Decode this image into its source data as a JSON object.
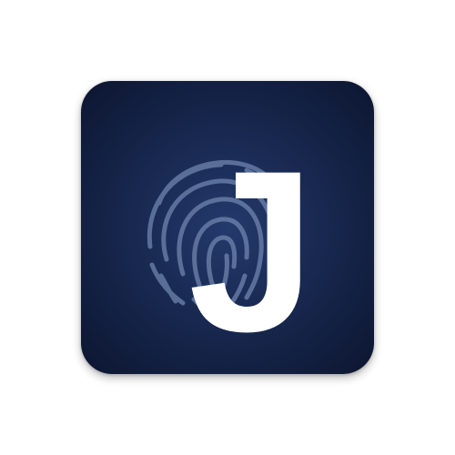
{
  "icon": {
    "letter": "J",
    "fingerprint_icon": "fingerprint-icon",
    "colors": {
      "background_center": "#243a6c",
      "background_edge": "#0c1630",
      "fingerprint_stroke": "#6f84ad",
      "letter_fill": "#ffffff"
    }
  }
}
